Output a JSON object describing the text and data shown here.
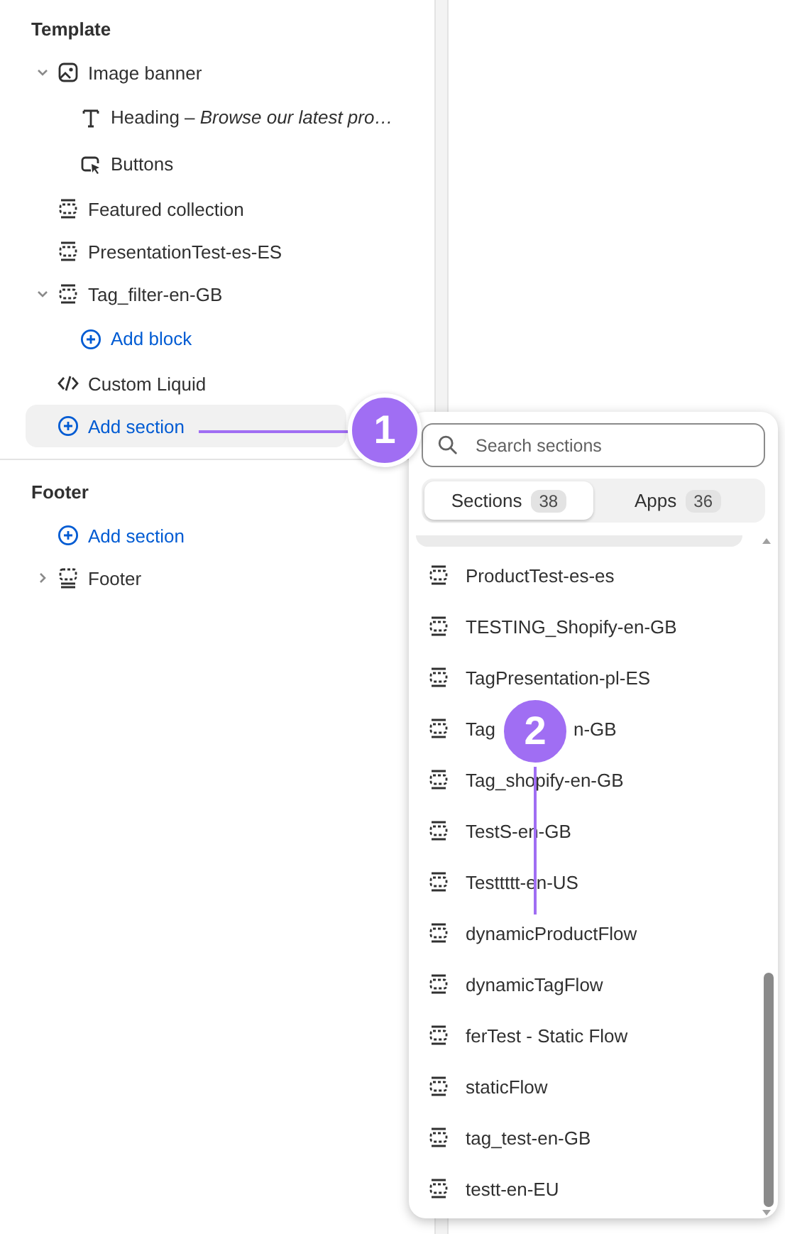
{
  "template": {
    "title": "Template",
    "items": [
      {
        "kind": "image",
        "label": "Image banner",
        "expanded": true,
        "highlighted": false,
        "children": [
          {
            "kind": "text",
            "label": "Heading – *Browse our latest pro…*"
          },
          {
            "kind": "pointer",
            "label": "Buttons"
          }
        ]
      },
      {
        "kind": "section",
        "label": "Featured collection",
        "highlighted": false
      },
      {
        "kind": "section",
        "label": "PresentationTest-es-ES",
        "highlighted": false
      },
      {
        "kind": "section",
        "label": "Tag_filter-en-GB",
        "expanded": true,
        "highlighted": false,
        "children": [
          {
            "kind": "add",
            "label": "Add block"
          }
        ]
      },
      {
        "kind": "code",
        "label": "Custom Liquid",
        "highlighted": false
      },
      {
        "kind": "add",
        "label": "Add section",
        "highlighted": true
      }
    ]
  },
  "footer": {
    "title": "Footer",
    "items": [
      {
        "kind": "add",
        "label": "Add section",
        "highlighted": false
      },
      {
        "kind": "footer",
        "label": "Footer",
        "expanded": false,
        "highlighted": false
      }
    ]
  },
  "popover": {
    "search": {
      "placeholder": "Search sections"
    },
    "tabs": [
      {
        "label": "Sections",
        "count": "38",
        "selected": true
      },
      {
        "label": "Apps",
        "count": "36",
        "selected": false
      }
    ],
    "items": [
      {
        "kind": "section",
        "label": "ProductTest-es-es"
      },
      {
        "kind": "section",
        "label": "TESTING_Shopify-en-GB"
      },
      {
        "kind": "section",
        "label": "TagPresentation-pl-ES"
      },
      {
        "kind": "covered",
        "label_start": "Tag",
        "label_end": "n-GB"
      },
      {
        "kind": "section",
        "label": "Tag_shopify-en-GB"
      },
      {
        "kind": "section",
        "label": "TestS-en-GB"
      },
      {
        "kind": "section",
        "label": "Testtttt-en-US"
      },
      {
        "kind": "section",
        "label": "dynamicProductFlow"
      },
      {
        "kind": "section",
        "label": "dynamicTagFlow"
      },
      {
        "kind": "section",
        "label": "ferTest - Static Flow"
      },
      {
        "kind": "section",
        "label": "staticFlow"
      },
      {
        "kind": "section",
        "label": "tag_test-en-GB"
      },
      {
        "kind": "section",
        "label": "testt-en-EU"
      }
    ]
  },
  "callouts": [
    {
      "number": "1"
    },
    {
      "number": "2"
    }
  ]
}
